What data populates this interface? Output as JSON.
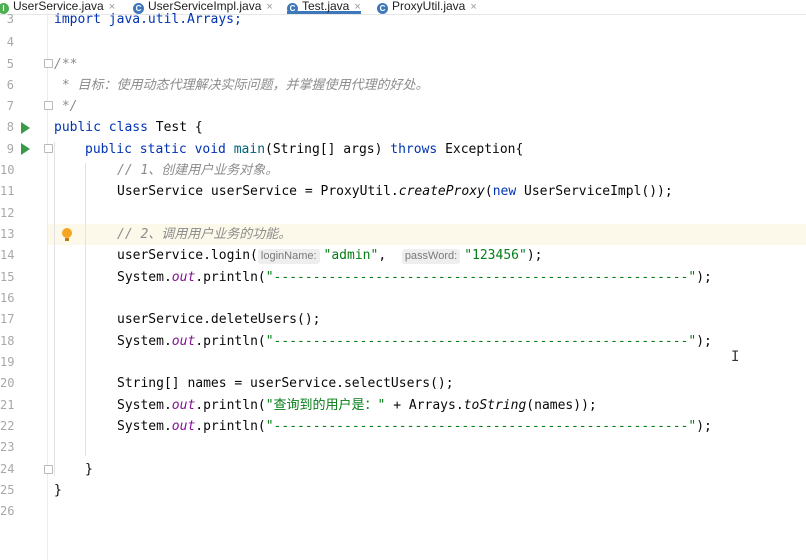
{
  "tabs": [
    {
      "label": "UserService.java",
      "icon": "I",
      "icon_color": "#4caf50",
      "active": false
    },
    {
      "label": "UserServiceImpl.java",
      "icon": "C",
      "icon_color": "#3d79ba",
      "active": false
    },
    {
      "label": "Test.java",
      "icon": "C",
      "icon_color": "#3d79ba",
      "active": true
    },
    {
      "label": "ProxyUtil.java",
      "icon": "C",
      "icon_color": "#3d79ba",
      "active": false
    }
  ],
  "close_glyph": "×",
  "line_numbers": [
    "3",
    "4",
    "5",
    "6",
    "7",
    "8",
    "9",
    "10",
    "11",
    "12",
    "13",
    "14",
    "15",
    "16",
    "17",
    "18",
    "19",
    "20",
    "21",
    "22",
    "23",
    "24",
    "25",
    "26"
  ],
  "code": {
    "l3": "import java.util.Arrays;",
    "l5": "/**",
    "l6": " * 目标：使用动态代理解决实际问题，并掌握使用代理的好处。",
    "l7": " */",
    "l8_kw": "public class ",
    "l8_rest": "Test {",
    "l9_kw1": "public static void ",
    "l9_fn": "main",
    "l9_mid": "(String[] args) ",
    "l9_kw2": "throws ",
    "l9_rest": "Exception{",
    "l10": "// 1、创建用户业务对象。",
    "l11_a": "UserService userService = ProxyUtil.",
    "l11_b": "createProxy",
    "l11_c": "(",
    "l11_kw": "new ",
    "l11_d": "UserServiceImpl());",
    "l13": "// 2、调用用户业务的功能。",
    "l14_a": "userService.login(",
    "l14_hint1": "loginName:",
    "l14_s1": "\"admin\"",
    "l14_b": ",  ",
    "l14_hint2": "passWord:",
    "l14_s2": "\"123456\"",
    "l14_c": ");",
    "sys": "System.",
    "out": "out",
    "println": ".println(",
    "dashes": "\"-----------------------------------------------------\"",
    "close": ");",
    "l17": "userService.deleteUsers();",
    "l20": "String[] names = userService.selectUsers();",
    "l21_s": "\"查询到的用户是：\"",
    "l21_b": " + Arrays.",
    "l21_it": "toString",
    "l21_c": "(names));",
    "brace": "}"
  },
  "text_cursor": "I"
}
